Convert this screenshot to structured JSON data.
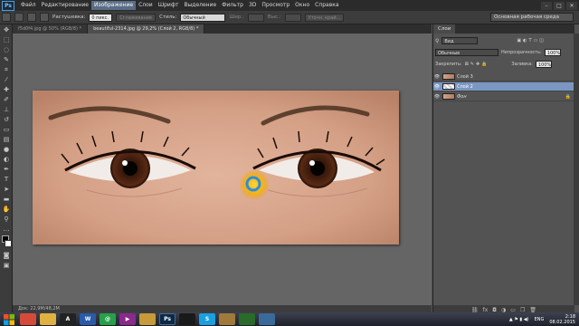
{
  "app": {
    "logo": "Ps"
  },
  "menu": [
    "Файл",
    "Редактирование",
    "Изображение",
    "Слои",
    "Шрифт",
    "Выделение",
    "Фильтр",
    "3D",
    "Просмотр",
    "Окно",
    "Справка"
  ],
  "menu_active_index": 2,
  "window_controls": [
    "–",
    "□",
    "✕"
  ],
  "options": {
    "feather_label": "Растушевка:",
    "feather_value": "0 пикс.",
    "antialias": "Сглаживание",
    "style_label": "Стиль:",
    "style_value": "Обычный",
    "width_label": "Шир.:",
    "height_label": "Выс.:",
    "refine_edge": "Уточн. край...",
    "workspace": "Основная рабочая среда"
  },
  "tabs": [
    {
      "label": "f5d0f4.jpg @ 50% (RGB/8) *"
    },
    {
      "label": "beautiful-2314.jpg @ 29,2% (Слой 2, RGB/8) *"
    }
  ],
  "status": "Док: 22,9M/48,2M",
  "panel": {
    "title": "Слои",
    "kind_label": "Вид",
    "blend_mode": "Обычные",
    "opacity_label": "Непрозрачность:",
    "opacity_value": "100%",
    "lock_label": "Закрепить:",
    "fill_label": "Заливка:",
    "fill_value": "100%",
    "layers": [
      {
        "name": "Слой 3",
        "selected": false
      },
      {
        "name": "Слой 2",
        "selected": true
      },
      {
        "name": "Фон",
        "selected": false
      }
    ]
  },
  "taskbar": {
    "apps": [
      {
        "name": "chrome",
        "label": "",
        "color": "#d64a3a"
      },
      {
        "name": "explorer",
        "label": "",
        "color": "#e0b040"
      },
      {
        "name": "font",
        "label": "A",
        "color": "#222"
      },
      {
        "name": "word",
        "label": "W",
        "color": "#2b5aa8"
      },
      {
        "name": "app-green",
        "label": "@",
        "color": "#27a04a"
      },
      {
        "name": "media",
        "label": "▶",
        "color": "#8a2a8a"
      },
      {
        "name": "folder",
        "label": "",
        "color": "#c89a3a"
      },
      {
        "name": "photoshop",
        "label": "Ps",
        "color": "#0a2a4a"
      },
      {
        "name": "capture",
        "label": "",
        "color": "#1a1a1a"
      },
      {
        "name": "skype",
        "label": "S",
        "color": "#1aa0e0"
      },
      {
        "name": "notes",
        "label": "",
        "color": "#a07a3a"
      },
      {
        "name": "video",
        "label": "",
        "color": "#2a6a2a"
      },
      {
        "name": "images",
        "label": "",
        "color": "#3a6a9a"
      }
    ],
    "lang": "ENG",
    "time": "2:18",
    "date": "08.02.2015"
  }
}
